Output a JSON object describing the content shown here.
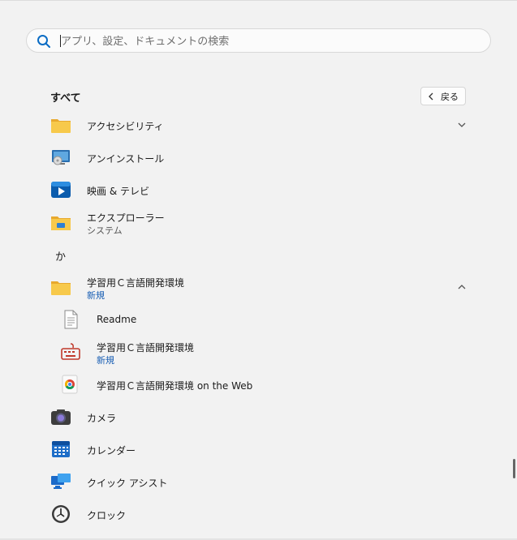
{
  "search": {
    "placeholder": "アプリ、設定、ドキュメントの検索"
  },
  "list": {
    "heading": "すべて",
    "back_label": "戻る",
    "section_letter": "か"
  },
  "apps": [
    {
      "name": "アクセシビリティ",
      "icon": "folder-icon"
    },
    {
      "name": "アンインストール",
      "icon": "uninstall-icon"
    },
    {
      "name": "映画 & テレビ",
      "icon": "movies-tv-icon"
    },
    {
      "name": "エクスプローラー",
      "sub": "システム",
      "icon": "file-explorer-icon"
    },
    {
      "name": "学習用Ｃ言語開発環境",
      "sub": "新規",
      "icon": "folder-icon"
    },
    {
      "name": "Readme",
      "icon": "document-icon"
    },
    {
      "name": "学習用Ｃ言語開発環境",
      "sub": "新規",
      "icon": "keyboard-icon"
    },
    {
      "name": "学習用Ｃ言語開発環境 on the Web",
      "icon": "chrome-icon"
    },
    {
      "name": "カメラ",
      "icon": "camera-icon"
    },
    {
      "name": "カレンダー",
      "icon": "calendar-icon"
    },
    {
      "name": "クイック アシスト",
      "icon": "quick-assist-icon"
    },
    {
      "name": "クロック",
      "icon": "clock-icon"
    }
  ],
  "colors": {
    "background": "#f2f2f2",
    "accent": "#0067c0",
    "new_badge": "#1a5fb4",
    "folder": "#f5c242"
  }
}
